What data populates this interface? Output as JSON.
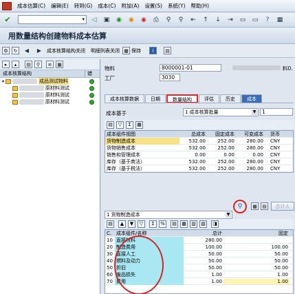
{
  "menu": [
    "成本估算(C)",
    "编辑(E)",
    "转到(G)",
    "成本(C)",
    "附加(A)",
    "设置(S)",
    "系统(Y)",
    "帮助(H)"
  ],
  "window_title": "用数量结构创建物料成本估算",
  "toolbar2": {
    "cost_structure_close": "成本核算结构关闭",
    "detail_list_close": "明细列表关闭",
    "save": "保持"
  },
  "tree": {
    "header_col1": "成本核算结构",
    "header_col2": "错",
    "rows": [
      {
        "label": "成品测试物料"
      },
      {
        "label": "原材料测试"
      },
      {
        "label": "原材料测试"
      },
      {
        "label": "原材料测试"
      }
    ]
  },
  "header_fields": {
    "material_label": "物料",
    "material_value": "8000001-01",
    "plant_label": "工厂",
    "plant_value": "3030",
    "right_cut": "料0."
  },
  "tabs": [
    "成本核算数据",
    "日期",
    "数量结构",
    "评估",
    "历史",
    "成本"
  ],
  "cost_base": {
    "label": "成本基于",
    "value": "1 成本核算批量",
    "qty": "1"
  },
  "summary_table": {
    "headers": [
      "成本组件视图",
      "总成本",
      "固定成本",
      "可变成本",
      "货币"
    ],
    "rows": [
      [
        "货物制造成本",
        "532.00",
        "252.00",
        "280.00",
        "CNY"
      ],
      [
        "货物销售成本",
        "532.00",
        "252.00",
        "280.00",
        "CNY"
      ],
      [
        "销售和管理成本",
        "0.00",
        "0.00",
        "0.00",
        "CNY"
      ],
      [
        "库存（基于商法）",
        "532.00",
        "252.00",
        "280.00",
        "CNY"
      ],
      [
        "库存（基于税法）",
        "532.00",
        "252.00",
        "280.00",
        "CNY"
      ]
    ]
  },
  "view_select": {
    "value": "1 货物制造成本",
    "merge_label": "合计人"
  },
  "component_table": {
    "headers": [
      "C.",
      "成本组件/名称",
      "总计",
      "固定"
    ],
    "rows": [
      [
        "10",
        "直接材料",
        "280.00",
        ""
      ],
      [
        "20",
        "制造费用",
        "100.00",
        "100.00"
      ],
      [
        "30",
        "直接人工",
        "50.00",
        "50.00"
      ],
      [
        "40",
        "燃料及动力",
        "50.00",
        "50.00"
      ],
      [
        "50",
        "折旧",
        "50.00",
        "50.00"
      ],
      [
        "60",
        "废品损失",
        "1.00",
        "1.00"
      ],
      [
        "70",
        "费用",
        "1.00",
        "1.00"
      ]
    ]
  }
}
